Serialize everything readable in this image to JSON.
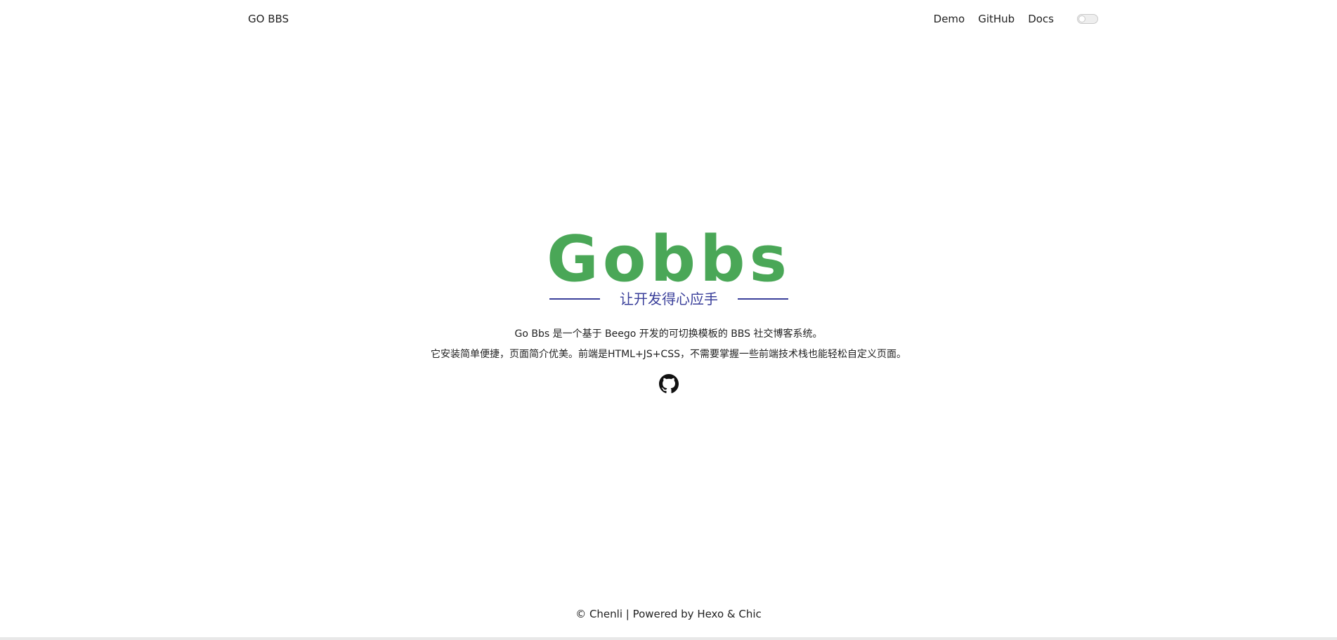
{
  "header": {
    "site_title": "GO BBS",
    "nav": [
      {
        "label": "Demo"
      },
      {
        "label": "GitHub"
      },
      {
        "label": "Docs"
      }
    ]
  },
  "hero": {
    "logo_word": "Gobbs",
    "logo_slogan": "让开发得心应手",
    "description_lines": [
      "Go Bbs 是一个基于 Beego 开发的可切换模板的 BBS 社交博客系统。",
      "它安装简单便捷，页面简介优美。前端是HTML+JS+CSS，不需要掌握一些前端技术栈也能轻松自定义页面。"
    ],
    "social_icon": "github-icon"
  },
  "footer": {
    "copyright": "© Chenli",
    "separator": " | Powered by ",
    "hexo": "Hexo",
    "amp": " & ",
    "chic": "Chic"
  },
  "colors": {
    "logo_green": "#4aa757",
    "slogan_blue": "#3a3f9a",
    "text": "#222222"
  }
}
